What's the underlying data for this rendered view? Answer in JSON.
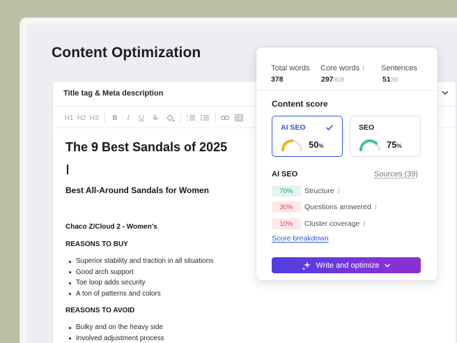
{
  "page": {
    "title": "Content Optimization"
  },
  "editor": {
    "meta_label": "Title tag & Meta description",
    "toolbar": [
      "H1",
      "H2",
      "H3",
      "bold-icon",
      "italic-icon",
      "underline-icon",
      "strikethrough-icon",
      "fill-color-icon",
      "numbered-list-icon",
      "bulleted-list-icon",
      "link-icon",
      "table-icon"
    ],
    "toolbar_text": {
      "h1": "H1",
      "h2": "H2",
      "h3": "H3",
      "bold": "B",
      "italic": "I",
      "underline": "U",
      "strike": "S"
    },
    "document": {
      "h1": "The 9 Best Sandals of 2025",
      "h2": "Best All-Around Sandals for Women",
      "h3": "Chaco Z/Cloud 2 - Women's",
      "reasons_buy_label": "REASONS TO BUY",
      "reasons_buy": [
        "Superior stability and traction in all situations",
        "Good arch support",
        "Toe loop adds security",
        "A ton of patterns and colors"
      ],
      "reasons_avoid_label": "REASONS TO AVOID",
      "reasons_avoid": [
        "Bulky and on the heavy side",
        "Involved adjustment process"
      ]
    }
  },
  "panel": {
    "stats": [
      {
        "label": "Total words",
        "value": "378",
        "total": ""
      },
      {
        "label": "Core words",
        "value": "297",
        "total": "/628"
      },
      {
        "label": "Sentences",
        "value": "51",
        "total": "/90"
      }
    ],
    "content_score_title": "Content score",
    "scores": [
      {
        "name": "AI SEO",
        "value": "50",
        "unit": "%",
        "fraction": 0.5,
        "gauge_color": "#f2b01e",
        "active": true
      },
      {
        "name": "SEO",
        "value": "75",
        "unit": "%",
        "fraction": 0.75,
        "gauge_color": "#4bbfa0",
        "active": false
      }
    ],
    "ai_seo_title": "AI SEO",
    "sources_link": "Sources (39)",
    "metrics": [
      {
        "value": "70%",
        "label": "Structure",
        "bg": "#e2f5ef",
        "fg": "#2e9b7c"
      },
      {
        "value": "30%",
        "label": "Questions answered",
        "bg": "#fde8ea",
        "fg": "#e0414f"
      },
      {
        "value": "10%",
        "label": "Cluster coverage",
        "bg": "#fde8ea",
        "fg": "#e0414f"
      }
    ],
    "breakdown_link": "Score breakdown",
    "write_button": "Write and optimize",
    "colors": {
      "accent": "#2b58e6",
      "button_start": "#4e3fe0",
      "button_end": "#8d2fd2"
    }
  }
}
